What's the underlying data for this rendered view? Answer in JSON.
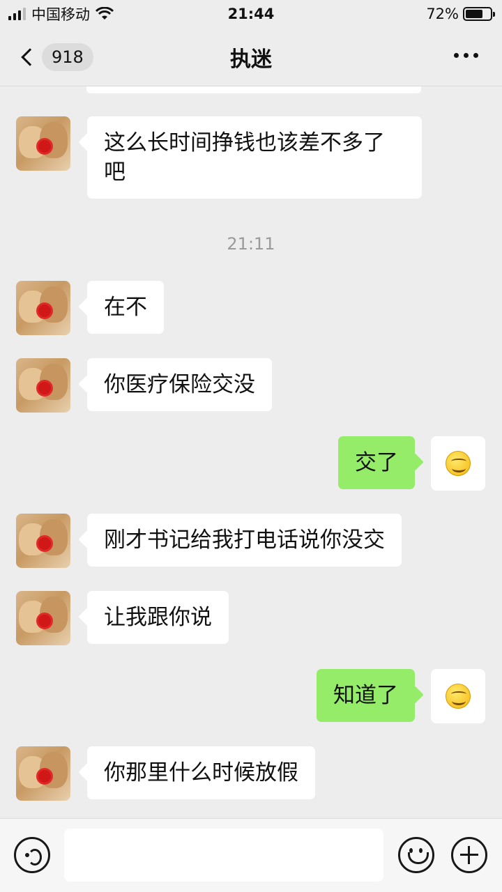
{
  "status_bar": {
    "carrier": "中国移动",
    "time": "21:44",
    "battery_text": "72%",
    "battery_level": 0.72,
    "icons": [
      "signal-icon",
      "wifi-icon",
      "battery-icon"
    ]
  },
  "nav": {
    "back_icon": "chevron-left-icon",
    "unread_count": "918",
    "title": "执迷",
    "more_icon": "more-dots-icon"
  },
  "chat": {
    "timestamp": "21:11",
    "messages": [
      {
        "side": "left",
        "text": "这么长时间挣钱也该差不多了吧"
      },
      {
        "side": "left",
        "text": "在不"
      },
      {
        "side": "left",
        "text": "你医疗保险交没"
      },
      {
        "side": "right",
        "text": "交了"
      },
      {
        "side": "left",
        "text": "刚才书记给我打电话说你没交"
      },
      {
        "side": "left",
        "text": "让我跟你说"
      },
      {
        "side": "right",
        "text": "知道了"
      },
      {
        "side": "left",
        "text": "你那里什么时候放假"
      }
    ]
  },
  "input_bar": {
    "voice_icon": "voice-icon",
    "input_value": "",
    "emoji_icon": "emoji-icon",
    "plus_icon": "plus-icon"
  }
}
